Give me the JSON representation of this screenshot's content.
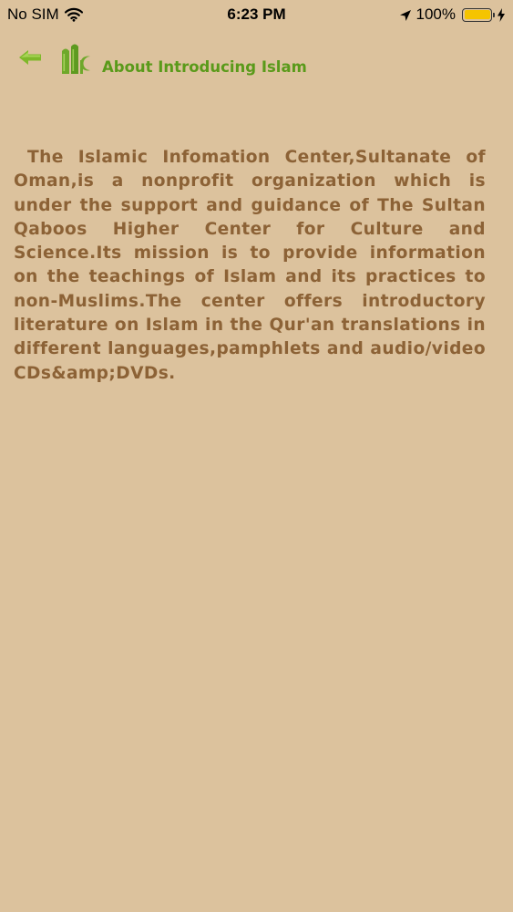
{
  "status_bar": {
    "carrier": "No SIM",
    "time": "6:23 PM",
    "battery_percent_label": "100%",
    "battery_level": 1.0,
    "icons": [
      "wifi-icon",
      "location-arrow-icon",
      "battery-icon",
      "charging-bolt-icon"
    ]
  },
  "header": {
    "back_icon": "back-arrow-icon",
    "logo_icon": "app-logo-icon",
    "title": "About Introducing Islam"
  },
  "about": {
    "text": "The Islamic Infomation Center,Sultanate of Oman,is a nonprofit organization which is under the support and guidance of The Sultan Qaboos Higher Center for Culture and Science.Its mission is to provide information on the teachings of Islam and its practices to non-Muslims.The center offers introductory literature on Islam in the Qur'an translations in different languages,pamphlets and audio/video CDs&amp;DVDs."
  },
  "colors": {
    "background": "#dcc29d",
    "title_green": "#5a9a1a",
    "body_text_brown": "#8c6236",
    "battery_yellow": "#f5c400"
  }
}
